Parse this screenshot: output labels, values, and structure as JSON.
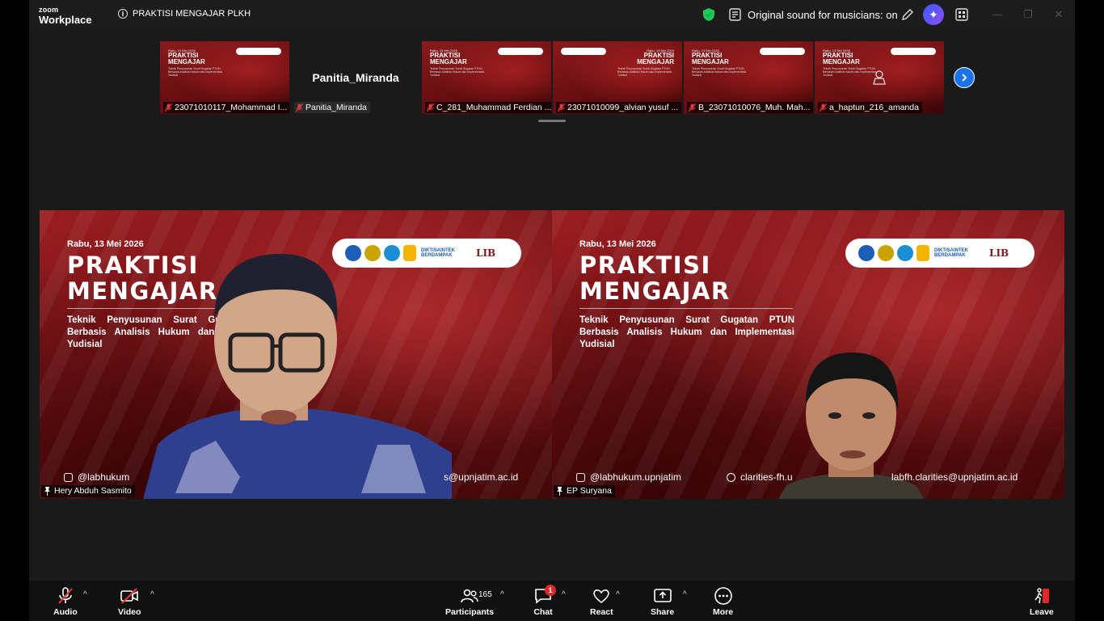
{
  "window": {
    "brand_small": "zoom",
    "brand_large": "Workplace",
    "meeting_title": "PRAKTISI MENGAJAR PLKH",
    "sound_label": "Original sound for musicians: on"
  },
  "thumbnails": [
    {
      "name": "23071010117_Mohammad I...",
      "muted": true,
      "video": "slide"
    },
    {
      "name": "Panitia_Miranda",
      "muted": true,
      "video": "none",
      "display_name": "Panitia_Miranda"
    },
    {
      "name": "C_281_Muhammad Ferdian ...",
      "muted": true,
      "video": "slide"
    },
    {
      "name": "23071010099_alvian yusuf ...",
      "muted": true,
      "video": "slide"
    },
    {
      "name": "B_23071010076_Muh. Mah...",
      "muted": true,
      "video": "slide"
    },
    {
      "name": "a_haptun_216_amanda",
      "muted": true,
      "video": "slide"
    }
  ],
  "slide": {
    "date": "Rabu, 13 Mei 2026",
    "title_line1": "PRAKTISI",
    "title_line2": "MENGAJAR",
    "subtitle": "Teknik Penyusunan Surat Gugatan PTUN Berbasis Analisis Hukum dan Implementasi Yudisial",
    "thumb_date": "Rabu, 13 Mei 2026",
    "logo_text": "DIKTISAINTEK BERDAMPAK",
    "logo_lib": "LIB",
    "instagram": "@labhukum.upnjatim",
    "website": "clarities-fh.u",
    "email": "labfh.clarities@upnjatim.ac.id",
    "instagram_cut": "@labhukum",
    "email_cut": "s@upnjatim.ac.id"
  },
  "speakers": [
    {
      "name": "Hery Abduh Sasmito",
      "active": true
    },
    {
      "name": "EP Suryana",
      "active": false
    }
  ],
  "toolbar": {
    "audio": "Audio",
    "video": "Video",
    "participants": "Participants",
    "participants_count": "165",
    "chat": "Chat",
    "chat_badge": "1",
    "react": "React",
    "share": "Share",
    "more": "More",
    "leave": "Leave"
  },
  "colors": {
    "active_speaker": "#2ed06e",
    "slide_red": "#8c1a1c",
    "next_button": "#1a73e8",
    "leave": "#e02828"
  }
}
